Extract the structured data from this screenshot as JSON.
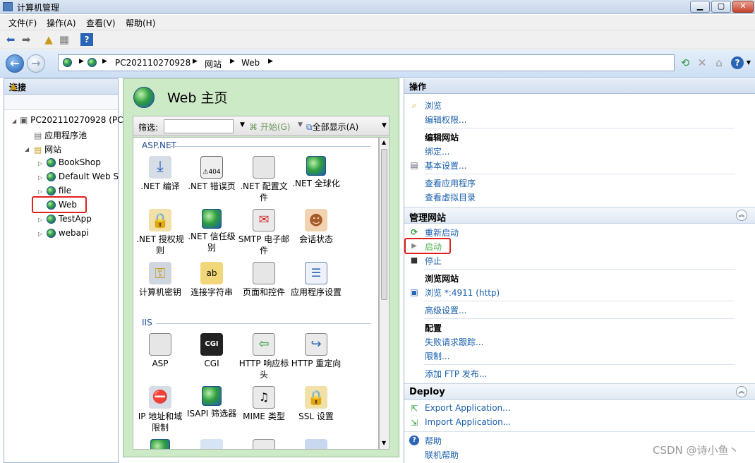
{
  "window": {
    "title": "计算机管理",
    "min_glyph": "▁",
    "max_glyph": "▢",
    "close_glyph": "✕"
  },
  "menu": [
    "文件(F)",
    "操作(A)",
    "查看(V)",
    "帮助(H)"
  ],
  "address": {
    "crumbs": [
      "PC202110270928",
      "网站",
      "Web"
    ]
  },
  "left": {
    "header": "连接",
    "tree": {
      "root": "PC202110270928 (PC",
      "apppool": "应用程序池",
      "sites": "网站",
      "items": [
        "BookShop",
        "Default Web S",
        "file",
        "Web",
        "TestApp",
        "webapi"
      ]
    }
  },
  "center": {
    "title": "Web 主页",
    "filter": {
      "label": "筛选:",
      "value": "",
      "start": "开始(G)",
      "showall": "全部显示(A)"
    },
    "groups": [
      {
        "name": "ASP.NET",
        "items": [
          ".NET 编译",
          ".NET 错误页",
          ".NET 配置文件",
          ".NET 全球化",
          ".NET 授权规则",
          ".NET 信任级别",
          "SMTP 电子邮件",
          "会话状态",
          "计算机密钥",
          "连接字符串",
          "页面和控件",
          "应用程序设置"
        ]
      },
      {
        "name": "IIS",
        "items": [
          "ASP",
          "CGI",
          "HTTP 响应标头",
          "HTTP 重定向",
          "IP 地址和域限制",
          "ISAPI 筛选器",
          "MIME 类型",
          "SSL 设置"
        ]
      }
    ]
  },
  "right": {
    "header": "操作",
    "browse": "浏览",
    "editperm": "编辑权限...",
    "editsite": "编辑网站",
    "bind": "绑定...",
    "basic": "基本设置...",
    "viewapps": "查看应用程序",
    "viewvdirs": "查看虚拟目录",
    "manage": "管理网站",
    "restart": "重新启动",
    "start": "启动",
    "stop": "停止",
    "browsesite": "浏览网站",
    "browseport": "浏览 *:4911 (http)",
    "advanced": "高级设置...",
    "config": "配置",
    "failedreq": "失败请求跟踪...",
    "limits": "限制...",
    "ftp": "添加 FTP 发布...",
    "deploy": "Deploy",
    "export": "Export Application...",
    "import": "Import Application...",
    "help": "帮助",
    "onlinehelp": "联机帮助"
  },
  "watermark": "CSDN @诗小鱼丶"
}
